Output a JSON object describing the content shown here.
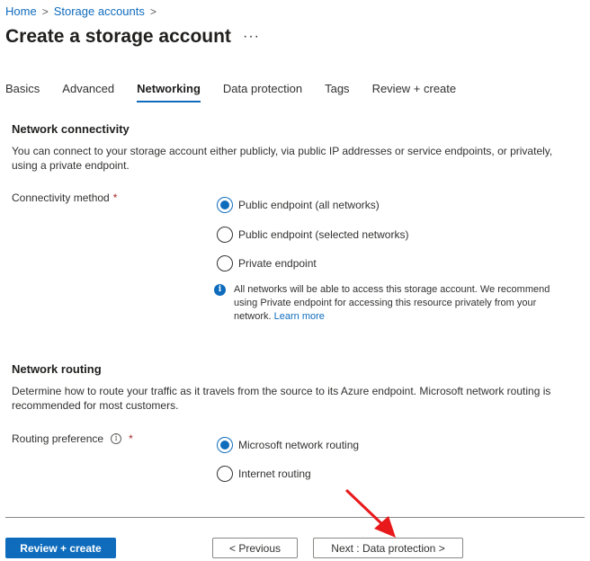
{
  "breadcrumb": {
    "home": "Home",
    "separator": ">",
    "storage_accounts": "Storage accounts",
    "trailing_separator": ">"
  },
  "page": {
    "title": "Create a storage account",
    "more": "···"
  },
  "tabs": [
    {
      "label": "Basics",
      "active": false
    },
    {
      "label": "Advanced",
      "active": false
    },
    {
      "label": "Networking",
      "active": true
    },
    {
      "label": "Data protection",
      "active": false
    },
    {
      "label": "Tags",
      "active": false
    },
    {
      "label": "Review + create",
      "active": false
    }
  ],
  "network_connectivity": {
    "heading": "Network connectivity",
    "description": "You can connect to your storage account either publicly, via public IP addresses or service endpoints, or privately, using a private endpoint.",
    "field_label": "Connectivity method",
    "required_mark": "*",
    "options": [
      {
        "label": "Public endpoint (all networks)",
        "selected": true
      },
      {
        "label": "Public endpoint (selected networks)",
        "selected": false
      },
      {
        "label": "Private endpoint",
        "selected": false
      }
    ],
    "info": {
      "icon": "info-icon",
      "text": "All networks will be able to access this storage account. We recommend using Private endpoint for accessing this resource privately from your network.",
      "link": "Learn more"
    }
  },
  "network_routing": {
    "heading": "Network routing",
    "description": "Determine how to route your traffic as it travels from the source to its Azure endpoint. Microsoft network routing is recommended for most customers.",
    "field_label": "Routing preference",
    "required_mark": "*",
    "info_glyph": "i",
    "options": [
      {
        "label": "Microsoft network routing",
        "selected": true
      },
      {
        "label": "Internet routing",
        "selected": false
      }
    ]
  },
  "footer": {
    "review_create": "Review + create",
    "previous": "< Previous",
    "next": "Next : Data protection >"
  },
  "colors": {
    "accent": "#0f6cbd",
    "required": "#a4262c",
    "annotation_arrow": "#e8191b"
  }
}
